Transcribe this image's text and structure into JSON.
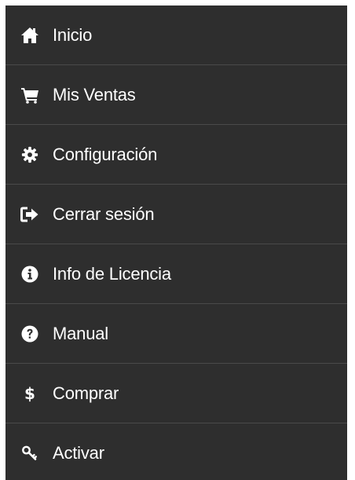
{
  "menu": {
    "items": [
      {
        "label": "Inicio",
        "icon": "home-icon"
      },
      {
        "label": "Mis Ventas",
        "icon": "cart-icon"
      },
      {
        "label": "Configuración",
        "icon": "gear-icon"
      },
      {
        "label": "Cerrar sesión",
        "icon": "sign-out-icon"
      },
      {
        "label": "Info de Licencia",
        "icon": "info-icon"
      },
      {
        "label": "Manual",
        "icon": "question-icon"
      },
      {
        "label": "Comprar",
        "icon": "dollar-icon",
        "glyph": "$"
      },
      {
        "label": "Activar",
        "icon": "key-icon"
      }
    ]
  },
  "colors": {
    "background": "#2e2e2e",
    "divider": "#4a4a4a",
    "text": "#ffffff"
  }
}
